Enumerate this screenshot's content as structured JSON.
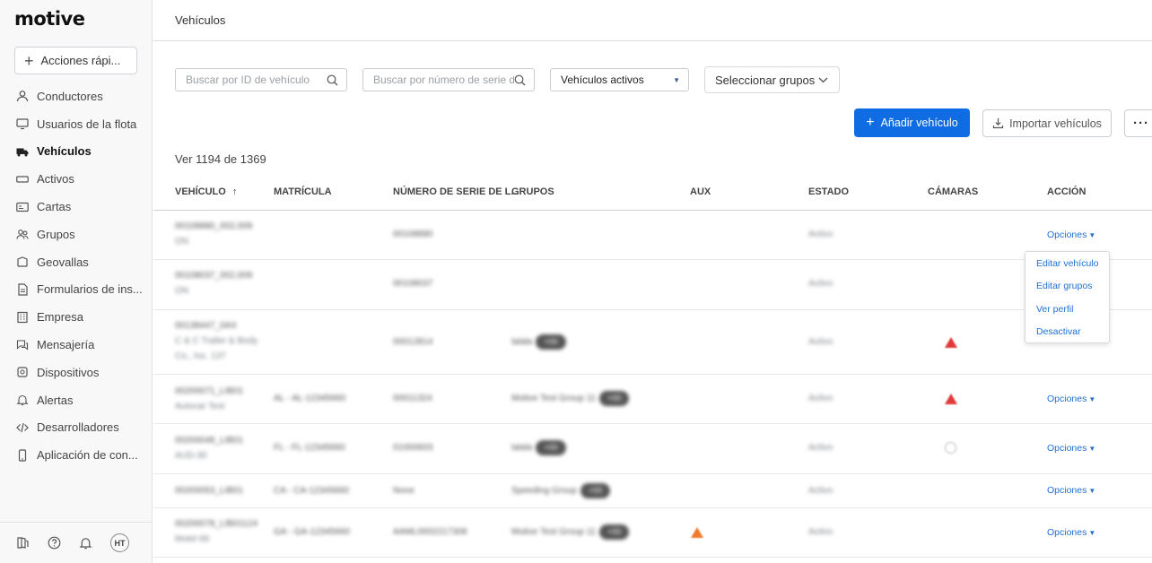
{
  "brand": {
    "logo": "motive"
  },
  "sidebar": {
    "quick_actions": "Acciones rápi...",
    "items": [
      {
        "label": "Conductores",
        "icon": "person-icon"
      },
      {
        "label": "Usuarios de la flota",
        "icon": "monitor-icon"
      },
      {
        "label": "Vehículos",
        "icon": "truck-icon",
        "active": true
      },
      {
        "label": "Activos",
        "icon": "trailer-icon"
      },
      {
        "label": "Cartas",
        "icon": "map-card-icon"
      },
      {
        "label": "Grupos",
        "icon": "group-icon"
      },
      {
        "label": "Geovallas",
        "icon": "geofence-icon"
      },
      {
        "label": "Formularios de ins...",
        "icon": "form-icon"
      },
      {
        "label": "Empresa",
        "icon": "building-icon"
      },
      {
        "label": "Mensajería",
        "icon": "chat-icon"
      },
      {
        "label": "Dispositivos",
        "icon": "device-icon"
      },
      {
        "label": "Alertas",
        "icon": "bell-icon"
      },
      {
        "label": "Desarrolladores",
        "icon": "code-icon"
      },
      {
        "label": "Aplicación de con...",
        "icon": "phone-icon"
      }
    ],
    "footer": {
      "avatar": "HT"
    }
  },
  "header": {
    "title": "Vehículos"
  },
  "filters": {
    "search_id_placeholder": "Buscar por ID de vehículo",
    "search_serial_placeholder": "Buscar por número de serie d",
    "status_select": "Vehículos activos",
    "groups_select": "Seleccionar grupos"
  },
  "actions": {
    "add_vehicle": "Añadir vehículo",
    "import_vehicles": "Importar vehículos",
    "more": "···"
  },
  "count_text": "Ver 1194 de 1369",
  "table": {
    "headers": {
      "vehicle": "VEHÍCULO",
      "sort_arrow": "↑",
      "plate": "MATRÍCULA",
      "serial": "NÚMERO DE SERIE DE L...",
      "groups": "GRUPOS",
      "aux": "AUX",
      "status": "ESTADO",
      "cameras": "CÁMARAS",
      "action": "ACCIÓN"
    },
    "rows": [
      {
        "vehicle_1": "00108880_002,009",
        "vehicle_2": "ON",
        "plate": "",
        "serial": "00108880",
        "group": "",
        "group_pill": "",
        "status": "Activo",
        "camera": "",
        "aux": "",
        "options": ""
      },
      {
        "vehicle_1": "00108037_002,009",
        "vehicle_2": "ON",
        "plate": "",
        "serial": "00108037",
        "group": "",
        "group_pill": "",
        "status": "Activo",
        "camera": "",
        "aux": "",
        "options": ""
      },
      {
        "vehicle_1": "00138447_0AX",
        "vehicle_2": "C & C Trailer & Body",
        "vehicle_3": "Co., Inc. 137",
        "plate": "",
        "serial": "00012814",
        "group": "lalala",
        "group_pill": "+00",
        "status": "Activo",
        "camera": "red-warning-icon",
        "aux": "",
        "options": "Opciones"
      },
      {
        "vehicle_1": "00200071_LIB01",
        "vehicle_2": "Autocar Test",
        "plate": "AL - AL-12345660",
        "serial": "00011324",
        "group": "Motive Test Group 11",
        "group_pill": "+00",
        "status": "Activo",
        "camera": "red-warning-icon",
        "aux": "",
        "options": "Opciones"
      },
      {
        "vehicle_1": "00200048_LIB01",
        "vehicle_2": "AUD-30",
        "plate": "FL - FL-12345660",
        "serial": "01000603",
        "group": "lalala",
        "group_pill": "+00",
        "status": "Activo",
        "camera": "camera-offline-icon",
        "aux": "",
        "options": "Opciones"
      },
      {
        "vehicle_1": "00200053_LIB01",
        "vehicle_2": "",
        "plate": "CA - CA-12345660",
        "serial": "None",
        "group": "Speeding Group",
        "group_pill": "+00",
        "status": "Activo",
        "camera": "",
        "aux": "",
        "options": "Opciones"
      },
      {
        "vehicle_1": "00200078_LIB01124",
        "vehicle_2": "Motel 66",
        "plate": "GA - GA-12345660",
        "serial": "AAML0002217306",
        "group": "Motive Test Group 11",
        "group_pill": "+00",
        "status": "Activo",
        "camera": "",
        "aux": "orange-warning-icon",
        "options": "Opciones"
      }
    ]
  },
  "options_menu": {
    "items": [
      "Editar vehículo",
      "Editar grupos",
      "Ver perfil",
      "Desactivar"
    ]
  },
  "colors": {
    "primary": "#0f6ce3",
    "link": "#1f6fd6",
    "warning_red": "#e23a3a",
    "warning_orange": "#f07a2c"
  }
}
